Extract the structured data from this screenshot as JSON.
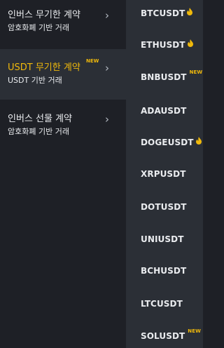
{
  "menu": [
    {
      "title": "인버스 무기한 계약",
      "subtitle": "암호화폐 기반 거래",
      "badge": "",
      "active": false
    },
    {
      "title": "USDT 무기한 계약",
      "subtitle": "USDT 기반 거래",
      "badge": "NEW",
      "active": true
    },
    {
      "title": "인버스 선물 계약",
      "subtitle": "암호화폐 기반 거래",
      "badge": "",
      "active": false
    }
  ],
  "symbols": [
    {
      "name": "BTCUSDT",
      "tag": "fire-icon"
    },
    {
      "name": "ETHUSDT",
      "tag": "fire-icon"
    },
    {
      "name": "BNBUSDT",
      "tag": "NEW"
    },
    {
      "name": "ADAUSDT",
      "tag": ""
    },
    {
      "name": "DOGEUSDT",
      "tag": "fire-icon"
    },
    {
      "name": "XRPUSDT",
      "tag": ""
    },
    {
      "name": "DOTUSDT",
      "tag": ""
    },
    {
      "name": "UNIUSDT",
      "tag": ""
    },
    {
      "name": "BCHUSDT",
      "tag": ""
    },
    {
      "name": "LTCUSDT",
      "tag": ""
    },
    {
      "name": "SOLUSDT",
      "tag": "NEW"
    }
  ],
  "colors": {
    "accent": "#f0b90b",
    "fire": "#f0b90b",
    "text": "#eaecef",
    "background_left": "#1e2026",
    "background_right": "#2b2f36"
  }
}
